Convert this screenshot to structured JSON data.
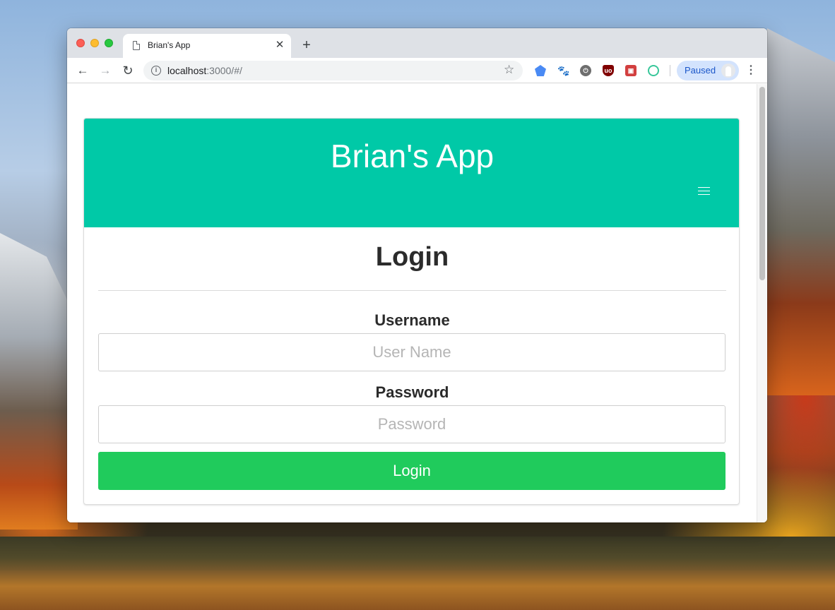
{
  "browser": {
    "tab": {
      "title": "Brian's App",
      "close_glyph": "✕"
    },
    "new_tab_glyph": "+",
    "nav": {
      "back_glyph": "←",
      "forward_glyph": "→",
      "reload_glyph": "↻"
    },
    "address_bar": {
      "host": "localhost",
      "rest": ":3000/#/"
    },
    "bookmark_glyph": "☆",
    "extensions": [
      "graduation-cap-icon",
      "paw-icon",
      "power-icon",
      "ublock-icon",
      "screenshot-icon",
      "refresh-ring-icon"
    ],
    "profile": {
      "label": "Paused"
    },
    "menu_glyph": "⋮"
  },
  "app": {
    "title": "Brian's App",
    "theme_color": "#00c9a7"
  },
  "login_form": {
    "heading": "Login",
    "username": {
      "label": "Username",
      "placeholder": "User Name",
      "value": ""
    },
    "password": {
      "label": "Password",
      "placeholder": "Password",
      "value": ""
    },
    "submit_label": "Login",
    "submit_color": "#20cb5c"
  }
}
